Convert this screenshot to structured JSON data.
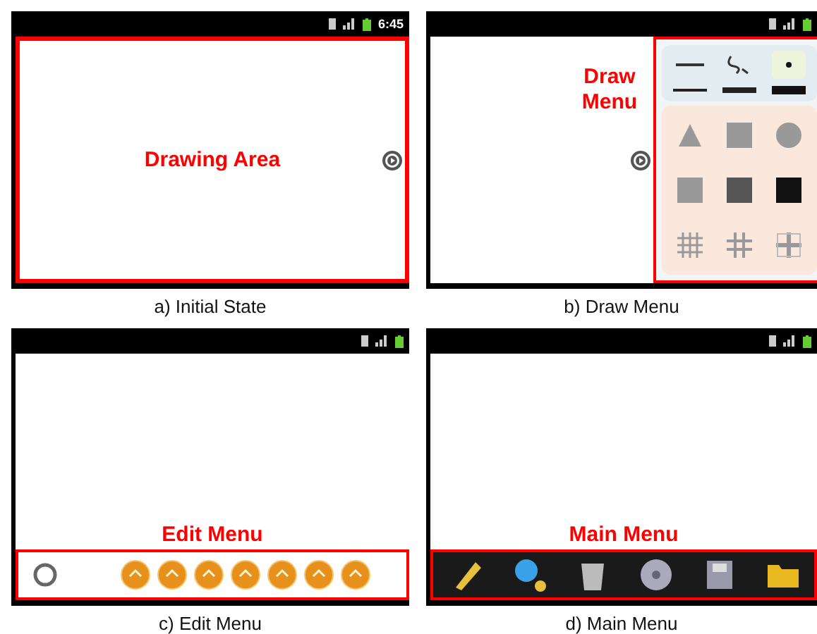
{
  "panels": [
    {
      "kind": "initial",
      "status_time": "6:45",
      "annotation": "Drawing Area",
      "caption": "a) Initial State"
    },
    {
      "kind": "draw",
      "annotation": "Draw Menu",
      "caption": "b) Draw Menu"
    },
    {
      "kind": "edit",
      "annotation": "Edit Menu",
      "caption": "c) Edit Menu"
    },
    {
      "kind": "main",
      "annotation": "Main Menu",
      "caption": "d) Main Menu"
    }
  ]
}
